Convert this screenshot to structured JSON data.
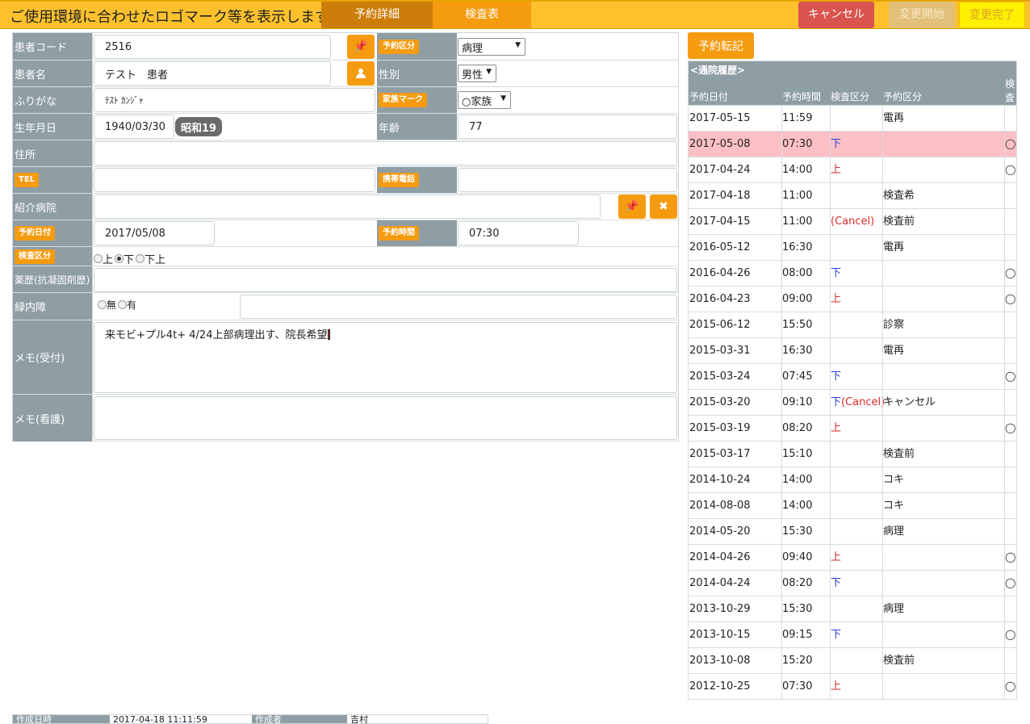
{
  "header": {
    "logo_text": "ご使用環境に合わせたロゴマーク等を表示します。",
    "tabs": [
      {
        "label": "予約詳細"
      },
      {
        "label": "検査表"
      }
    ],
    "cancel_label": "キャンセル",
    "start_label": "変更開始",
    "done_label": "変更完了"
  },
  "form": {
    "patient_code": {
      "label": "患者コード",
      "value": "2516"
    },
    "reservation_kind": {
      "label": "予約区分",
      "value": "病理"
    },
    "patient_name": {
      "label": "患者名",
      "value": "テスト　患者"
    },
    "sex": {
      "label": "性別",
      "value": "男性"
    },
    "furigana": {
      "label": "ふりがな",
      "value": "ﾃｽﾄ ｶﾝｼﾞｬ"
    },
    "family_mark": {
      "label": "家族マーク",
      "value": "○家族"
    },
    "birthdate": {
      "label": "生年月日",
      "value": "1940/03/30",
      "era": "昭和19"
    },
    "age": {
      "label": "年齢",
      "value": "77"
    },
    "address": {
      "label": "住所",
      "value": ""
    },
    "tel": {
      "label": "TEL",
      "value": ""
    },
    "mobile": {
      "label": "携帯電話",
      "value": ""
    },
    "referral": {
      "label": "紹介病院",
      "value": ""
    },
    "reserve_date": {
      "label": "予約日付",
      "value": "2017/05/08"
    },
    "reserve_time": {
      "label": "予約時間",
      "value": "07:30"
    },
    "exam_kind": {
      "label": "検査区分",
      "options": [
        "上",
        "下",
        "下上"
      ],
      "selected": "下"
    },
    "med_history": {
      "label": "薬歴(抗凝固剤歴)",
      "value": ""
    },
    "glaucoma": {
      "label": "緑内障",
      "options": [
        "無",
        "有"
      ],
      "selected": "",
      "note": ""
    },
    "memo_reception": {
      "label": "メモ(受付)",
      "value": "来モビ+プル4t+ 4/24上部病理出す、院長希望"
    },
    "memo_nursing": {
      "label": "メモ(看護)",
      "value": ""
    }
  },
  "history": {
    "transfer_label": "予約転記",
    "title": "<通院履歴>",
    "columns": {
      "date": "予約日付",
      "time": "予約時間",
      "exam": "検査区分",
      "kind": "予約区分",
      "mark": "検査"
    },
    "rows": [
      {
        "date": "2017-05-15",
        "time": "11:59",
        "exam": "",
        "cancel": "",
        "kind": "電再",
        "mark": ""
      },
      {
        "date": "2017-05-08",
        "time": "07:30",
        "exam": "下",
        "cancel": "",
        "kind": "",
        "mark": "◯"
      },
      {
        "date": "2017-04-24",
        "time": "14:00",
        "exam": "上",
        "cancel": "",
        "kind": "",
        "mark": "◯"
      },
      {
        "date": "2017-04-18",
        "time": "11:00",
        "exam": "",
        "cancel": "",
        "kind": "検査希",
        "mark": ""
      },
      {
        "date": "2017-04-15",
        "time": "11:00",
        "exam": "",
        "cancel": "(Cancel)",
        "kind": "検査前",
        "mark": ""
      },
      {
        "date": "2016-05-12",
        "time": "16:30",
        "exam": "",
        "cancel": "",
        "kind": "電再",
        "mark": ""
      },
      {
        "date": "2016-04-26",
        "time": "08:00",
        "exam": "下",
        "cancel": "",
        "kind": "",
        "mark": "◯"
      },
      {
        "date": "2016-04-23",
        "time": "09:00",
        "exam": "上",
        "cancel": "",
        "kind": "",
        "mark": "◯"
      },
      {
        "date": "2015-06-12",
        "time": "15:50",
        "exam": "",
        "cancel": "",
        "kind": "診察",
        "mark": ""
      },
      {
        "date": "2015-03-31",
        "time": "16:30",
        "exam": "",
        "cancel": "",
        "kind": "電再",
        "mark": ""
      },
      {
        "date": "2015-03-24",
        "time": "07:45",
        "exam": "下",
        "cancel": "",
        "kind": "",
        "mark": "◯"
      },
      {
        "date": "2015-03-20",
        "time": "09:10",
        "exam": "下",
        "cancel": "(Cancel)",
        "kind": "キャンセル",
        "mark": ""
      },
      {
        "date": "2015-03-19",
        "time": "08:20",
        "exam": "上",
        "cancel": "",
        "kind": "",
        "mark": "◯"
      },
      {
        "date": "2015-03-17",
        "time": "15:10",
        "exam": "",
        "cancel": "",
        "kind": "検査前",
        "mark": ""
      },
      {
        "date": "2014-10-24",
        "time": "14:00",
        "exam": "",
        "cancel": "",
        "kind": "コキ",
        "mark": ""
      },
      {
        "date": "2014-08-08",
        "time": "14:00",
        "exam": "",
        "cancel": "",
        "kind": "コキ",
        "mark": ""
      },
      {
        "date": "2014-05-20",
        "time": "15:30",
        "exam": "",
        "cancel": "",
        "kind": "病理",
        "mark": ""
      },
      {
        "date": "2014-04-26",
        "time": "09:40",
        "exam": "上",
        "cancel": "",
        "kind": "",
        "mark": "◯"
      },
      {
        "date": "2014-04-24",
        "time": "08:20",
        "exam": "下",
        "cancel": "",
        "kind": "",
        "mark": "◯"
      },
      {
        "date": "2013-10-29",
        "time": "15:30",
        "exam": "",
        "cancel": "",
        "kind": "病理",
        "mark": ""
      },
      {
        "date": "2013-10-15",
        "time": "09:15",
        "exam": "下",
        "cancel": "",
        "kind": "",
        "mark": "◯"
      },
      {
        "date": "2013-10-08",
        "time": "15:20",
        "exam": "",
        "cancel": "",
        "kind": "検査前",
        "mark": ""
      },
      {
        "date": "2012-10-25",
        "time": "07:30",
        "exam": "上",
        "cancel": "",
        "kind": "",
        "mark": "◯"
      }
    ],
    "selected_date": "2017-05-08",
    "highlight_color": "#fec0c5"
  },
  "footer": {
    "created_label": "作成日時",
    "created_value": "2017-04-18 11:11:59",
    "author_label": "作成者",
    "author_value": "吉村"
  }
}
